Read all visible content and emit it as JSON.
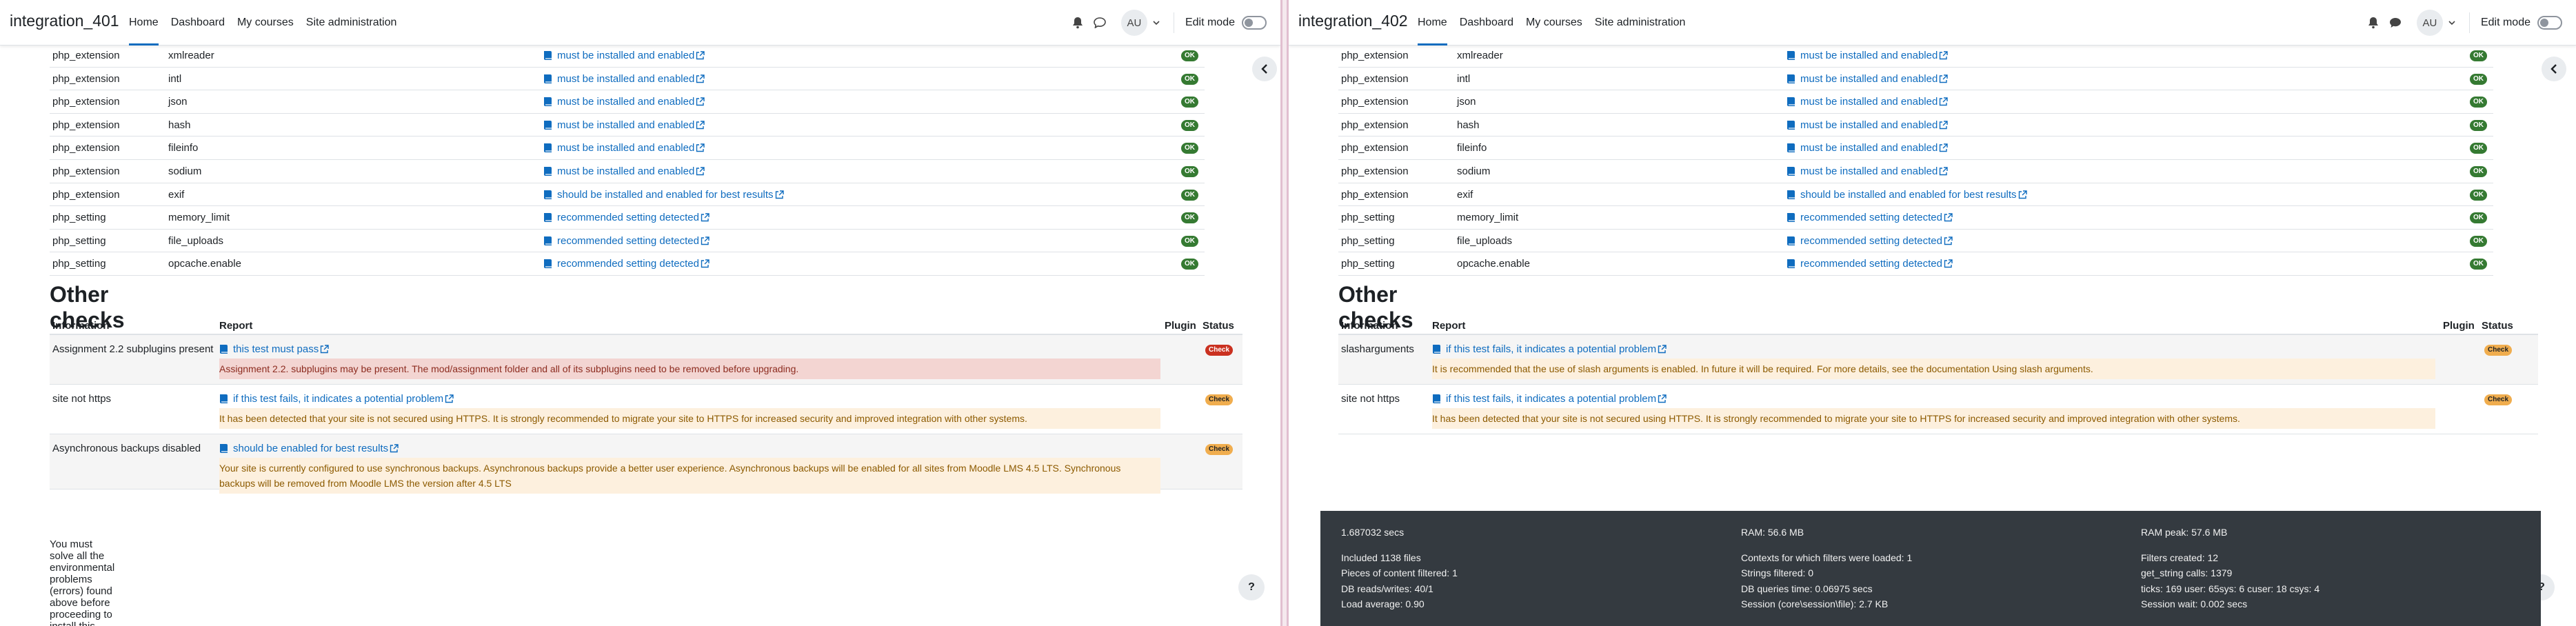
{
  "left": {
    "site_name": "integration_401",
    "nav": [
      "Home",
      "Dashboard",
      "My courses",
      "Site administration"
    ],
    "avatar": "AU",
    "edit_mode": "Edit mode",
    "extensions": [
      {
        "info": "php_extension",
        "name": "xmlreader",
        "report": "must be installed and enabled",
        "status": "OK"
      },
      {
        "info": "php_extension",
        "name": "intl",
        "report": "must be installed and enabled",
        "status": "OK"
      },
      {
        "info": "php_extension",
        "name": "json",
        "report": "must be installed and enabled",
        "status": "OK"
      },
      {
        "info": "php_extension",
        "name": "hash",
        "report": "must be installed and enabled",
        "status": "OK"
      },
      {
        "info": "php_extension",
        "name": "fileinfo",
        "report": "must be installed and enabled",
        "status": "OK"
      },
      {
        "info": "php_extension",
        "name": "sodium",
        "report": "must be installed and enabled",
        "status": "OK"
      },
      {
        "info": "php_extension",
        "name": "exif",
        "report": "should be installed and enabled for best results",
        "status": "OK"
      },
      {
        "info": "php_setting",
        "name": "memory_limit",
        "report": "recommended setting detected",
        "status": "OK"
      },
      {
        "info": "php_setting",
        "name": "file_uploads",
        "report": "recommended setting detected",
        "status": "OK"
      },
      {
        "info": "php_setting",
        "name": "opcache.enable",
        "report": "recommended setting detected",
        "status": "OK"
      }
    ],
    "other_checks_title": "Other checks",
    "headers": {
      "information": "Information",
      "report": "Report",
      "plugin": "Plugin",
      "status": "Status"
    },
    "checks": [
      {
        "info": "Assignment 2.2 subplugins present",
        "link": "this test must pass",
        "message": "Assignment 2.2. subplugins may be present. The mod/assignment folder and all of its subplugins need to be removed before upgrading.",
        "status": "Check",
        "level": "error"
      },
      {
        "info": "site not https",
        "link": "if this test fails, it indicates a potential problem",
        "message": "It has been detected that your site is not secured using HTTPS. It is strongly recommended to migrate your site to HTTPS for increased security and improved integration with other systems.",
        "status": "Check",
        "level": "warn"
      },
      {
        "info": "Asynchronous backups disabled",
        "link": "should be enabled for best results",
        "message": "Your site is currently configured to use synchronous backups. Asynchronous backups provide a better user experience. Asynchronous backups will be enabled for all sites from Moodle LMS 4.5 LTS. Synchronous backups will be removed from Moodle LMS the version after 4.5 LTS",
        "status": "Check",
        "level": "warn"
      }
    ],
    "footer_note": "You must solve all the environmental problems (errors) found above before proceeding to install this Moodle version!",
    "help": "?"
  },
  "right": {
    "site_name": "integration_402",
    "nav": [
      "Home",
      "Dashboard",
      "My courses",
      "Site administration"
    ],
    "avatar": "AU",
    "edit_mode": "Edit mode",
    "extensions": [
      {
        "info": "php_extension",
        "name": "xmlreader",
        "report": "must be installed and enabled",
        "status": "OK"
      },
      {
        "info": "php_extension",
        "name": "intl",
        "report": "must be installed and enabled",
        "status": "OK"
      },
      {
        "info": "php_extension",
        "name": "json",
        "report": "must be installed and enabled",
        "status": "OK"
      },
      {
        "info": "php_extension",
        "name": "hash",
        "report": "must be installed and enabled",
        "status": "OK"
      },
      {
        "info": "php_extension",
        "name": "fileinfo",
        "report": "must be installed and enabled",
        "status": "OK"
      },
      {
        "info": "php_extension",
        "name": "sodium",
        "report": "must be installed and enabled",
        "status": "OK"
      },
      {
        "info": "php_extension",
        "name": "exif",
        "report": "should be installed and enabled for best results",
        "status": "OK"
      },
      {
        "info": "php_setting",
        "name": "memory_limit",
        "report": "recommended setting detected",
        "status": "OK"
      },
      {
        "info": "php_setting",
        "name": "file_uploads",
        "report": "recommended setting detected",
        "status": "OK"
      },
      {
        "info": "php_setting",
        "name": "opcache.enable",
        "report": "recommended setting detected",
        "status": "OK"
      }
    ],
    "other_checks_title": "Other checks",
    "headers": {
      "information": "Information",
      "report": "Report",
      "plugin": "Plugin",
      "status": "Status"
    },
    "checks": [
      {
        "info": "slasharguments",
        "link": "if this test fails, it indicates a potential problem",
        "message": "It is recommended that the use of slash arguments is enabled. In future it will be required. For more details, see the documentation Using slash arguments.",
        "status": "Check",
        "level": "warn"
      },
      {
        "info": "site not https",
        "link": "if this test fails, it indicates a potential problem",
        "message": "It has been detected that your site is not secured using HTTPS. It is strongly recommended to migrate your site to HTTPS for increased security and improved integration with other systems.",
        "status": "Check",
        "level": "warn"
      }
    ],
    "perf": {
      "time": "1.687032 secs",
      "ram": "RAM: 56.6 MB",
      "ram_peak": "RAM peak: 57.6 MB",
      "included": "Included 1138 files",
      "contexts": "Contexts for which filters were loaded: 1",
      "filters_created": "Filters created: 12",
      "content_filtered": "Pieces of content filtered: 1",
      "strings_filtered": "Strings filtered: 0",
      "get_string": "get_string calls: 1379",
      "db_rw": "DB reads/writes: 40/1",
      "db_time": "DB queries time: 0.06975 secs",
      "ticks": "ticks: 169 user: 65sys: 6 cuser: 18 csys: 4",
      "load": "Load average: 0.90",
      "session": "Session (core\\session\\file): 2.7 KB",
      "session_wait": "Session wait: 0.002 secs"
    },
    "help": "?"
  },
  "colors": {
    "link": "#0f6cbf",
    "ok": "#357a32",
    "check": "#f0ad4e",
    "error": "#ca3120",
    "footer_bg": "#343a40"
  }
}
